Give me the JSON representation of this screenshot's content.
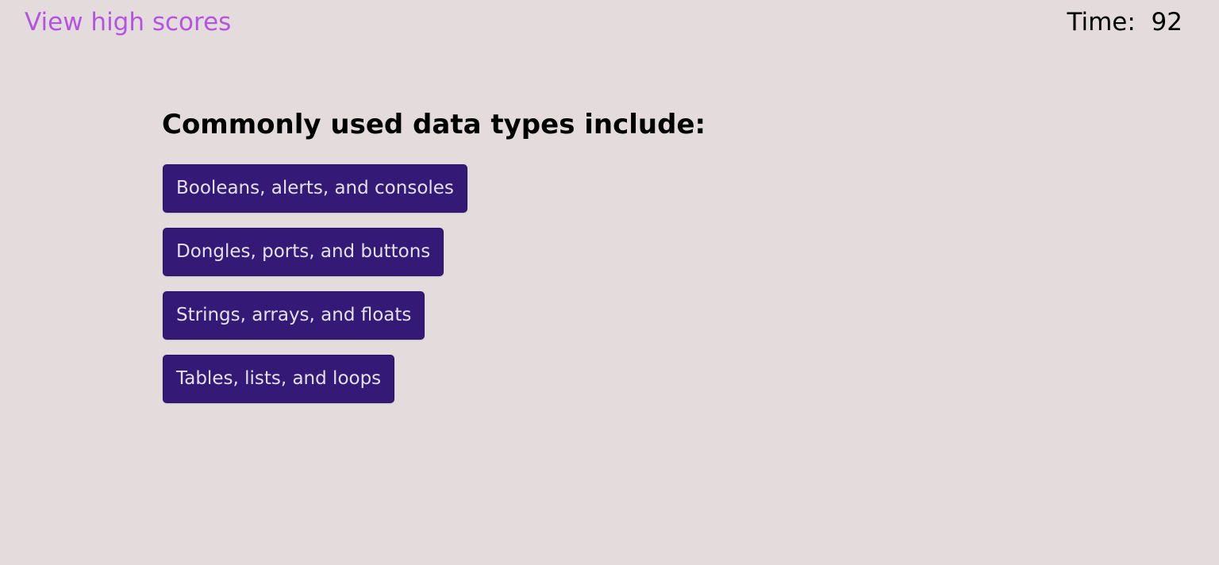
{
  "header": {
    "high_scores_label": "View high scores",
    "timer_label": "Time:",
    "timer_value": "92"
  },
  "question": {
    "title": "Commonly used data types include:",
    "answers": [
      {
        "label": "Booleans, alerts, and consoles"
      },
      {
        "label": "Dongles, ports, and buttons"
      },
      {
        "label": "Strings, arrays, and floats"
      },
      {
        "label": "Tables, lists, and loops"
      }
    ]
  },
  "colors": {
    "background": "#e3dbdc",
    "link": "#b455e0",
    "button_bg": "#341a76",
    "button_text": "#e6dfee"
  }
}
